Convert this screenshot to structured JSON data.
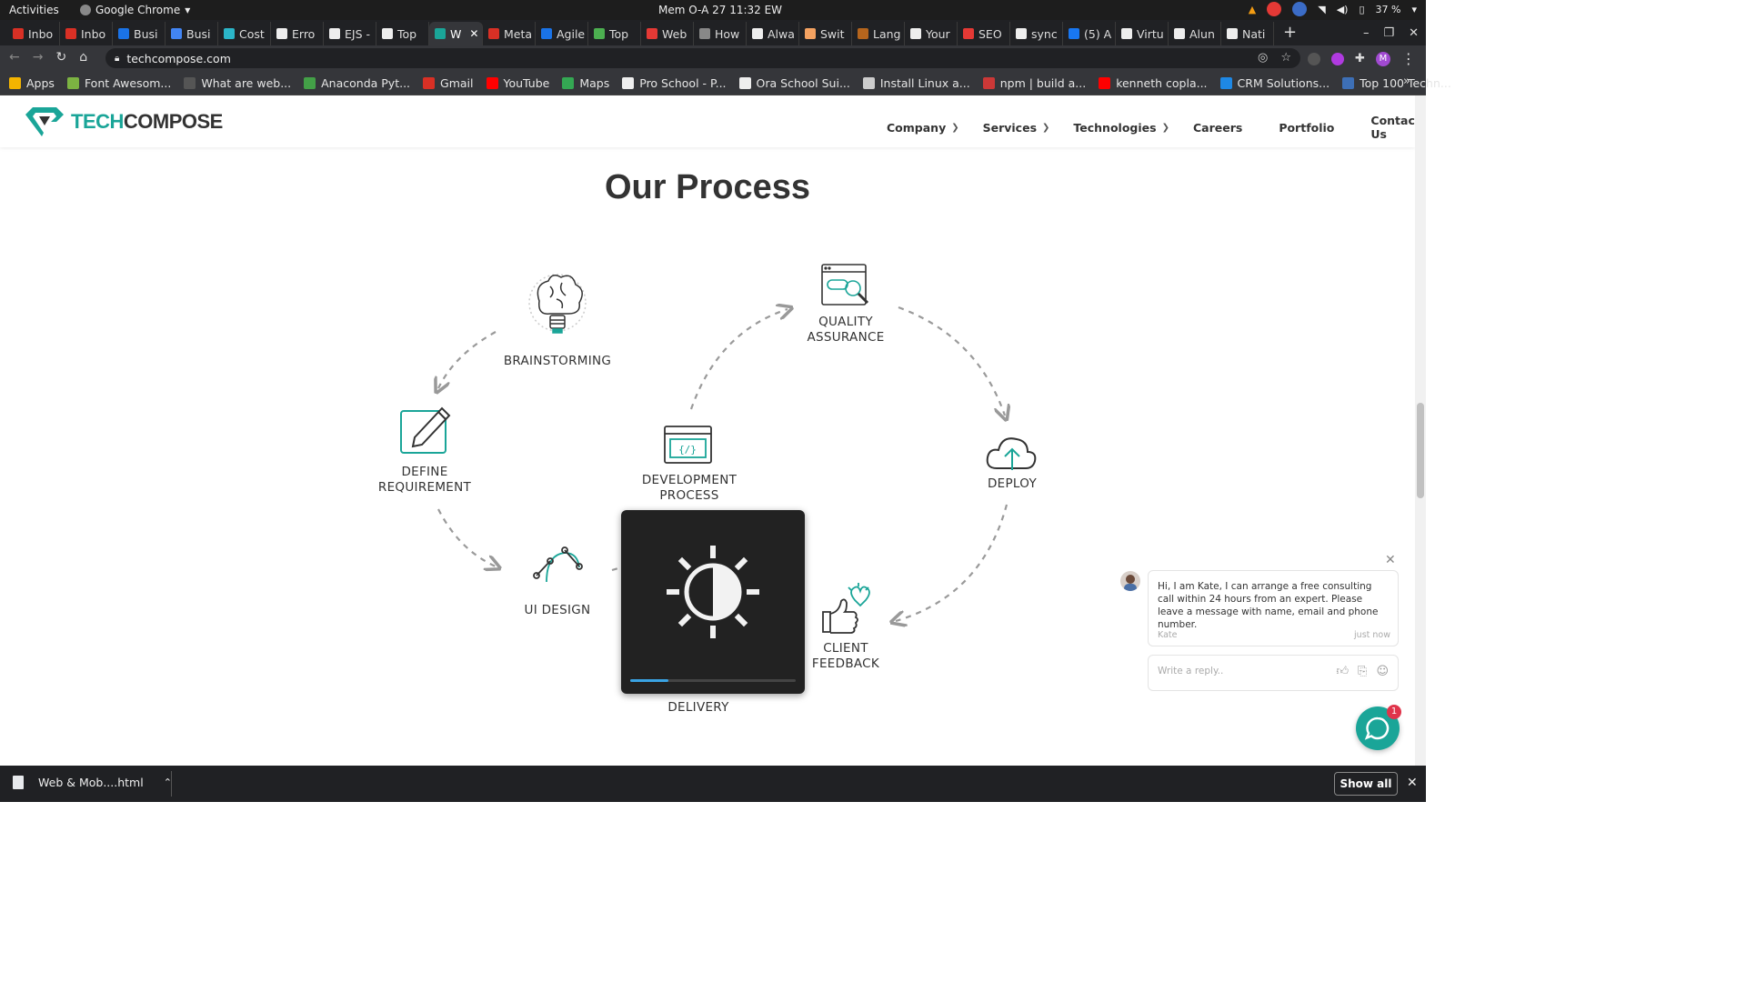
{
  "os": {
    "activities": "Activities",
    "app_name": "Google Chrome",
    "clock": "Mem O-A 27  11:32 EW",
    "battery": "37 %"
  },
  "tabs": [
    {
      "label": "Inbo",
      "color": "#d93025"
    },
    {
      "label": "Inbo",
      "color": "#d93025"
    },
    {
      "label": "Busi",
      "color": "#1a73e8"
    },
    {
      "label": "Busi",
      "color": "#4285f4"
    },
    {
      "label": "Cost",
      "color": "#2bb5c8"
    },
    {
      "label": "Erro",
      "color": "#eeeeee"
    },
    {
      "label": "EJS -",
      "color": "#eeeeee"
    },
    {
      "label": "Top",
      "color": "#eeeeee"
    },
    {
      "label": "W",
      "color": "#1aa598",
      "active": true
    },
    {
      "label": "Meta",
      "color": "#d93025"
    },
    {
      "label": "Agile",
      "color": "#1a73e8"
    },
    {
      "label": "Top",
      "color": "#4caf50"
    },
    {
      "label": "Web",
      "color": "#e53935"
    },
    {
      "label": "How",
      "color": "#888888"
    },
    {
      "label": "Alwa",
      "color": "#eeeeee"
    },
    {
      "label": "Swit",
      "color": "#f4a261"
    },
    {
      "label": "Lang",
      "color": "#b5651d"
    },
    {
      "label": "Your",
      "color": "#eeeeee"
    },
    {
      "label": "SEO",
      "color": "#e53935"
    },
    {
      "label": "sync",
      "color": "#eeeeee"
    },
    {
      "label": "(5) A",
      "color": "#1877f2"
    },
    {
      "label": "Virtu",
      "color": "#eeeeee"
    },
    {
      "label": "Alun",
      "color": "#eeeeee"
    },
    {
      "label": "Nati",
      "color": "#eeeeee"
    }
  ],
  "new_tab": "+",
  "url": "techcompose.com",
  "bookmarks": [
    {
      "label": "Apps",
      "color": "#f4b400"
    },
    {
      "label": "Font Awesom...",
      "color": "#7cb342"
    },
    {
      "label": "What are web...",
      "color": "#555555"
    },
    {
      "label": "Anaconda Pyt...",
      "color": "#43a047"
    },
    {
      "label": "Gmail",
      "color": "#d93025"
    },
    {
      "label": "YouTube",
      "color": "#ff0000"
    },
    {
      "label": "Maps",
      "color": "#34a853"
    },
    {
      "label": "Pro School - P...",
      "color": "#eeeeee"
    },
    {
      "label": "Ora School Sui...",
      "color": "#eeeeee"
    },
    {
      "label": "Install Linux a...",
      "color": "#cccccc"
    },
    {
      "label": "npm | build a...",
      "color": "#cb3837"
    },
    {
      "label": "kenneth copla...",
      "color": "#ff0000"
    },
    {
      "label": "CRM Solutions...",
      "color": "#1e88e5"
    },
    {
      "label": "Top 100 Techn...",
      "color": "#3d6fb6"
    }
  ],
  "site": {
    "logo_a": "TECH",
    "logo_b": "COMPOSE",
    "menu": [
      "Company",
      "Services",
      "Technologies",
      "Careers",
      "Portfolio",
      "Contact Us"
    ],
    "heading": "Our Process",
    "steps": {
      "brainstorming": "BRAINSTORMING",
      "quality1": "QUALITY",
      "quality2": "ASSURANCE",
      "define1": "DEFINE",
      "define2": "REQUIREMENT",
      "dev1": "DEVELOPMENT",
      "dev2": "PROCESS",
      "deploy": "DEPLOY",
      "ui": "UI DESIGN",
      "client1": "CLIENT",
      "client2": "FEEDBACK",
      "delivery": "DELIVERY"
    }
  },
  "brightness_overlay": {
    "level": 0.23
  },
  "chat": {
    "message": "Hi, I am Kate, I can arrange a free consulting call within 24 hours from an expert. Please leave a message with name, email and phone number.",
    "author": "Kate",
    "time": "just now",
    "reply_placeholder": "Write a reply..",
    "badge": "1"
  },
  "downloads": {
    "file": "Web & Mob....html",
    "show_all": "Show all"
  }
}
